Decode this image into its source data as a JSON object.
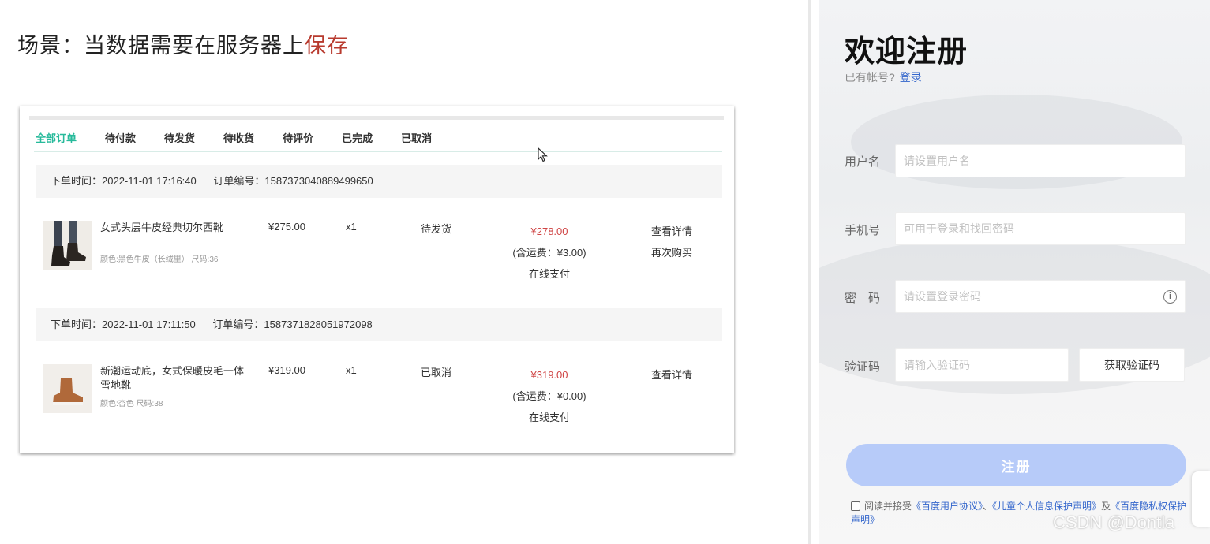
{
  "slide": {
    "title_prefix": "场景：当数据需要在服务器上",
    "title_highlight": "保存"
  },
  "orders": {
    "tabs": [
      {
        "label": "全部订单",
        "active": true
      },
      {
        "label": "待付款",
        "active": false
      },
      {
        "label": "待发货",
        "active": false
      },
      {
        "label": "待收货",
        "active": false
      },
      {
        "label": "待评价",
        "active": false
      },
      {
        "label": "已完成",
        "active": false
      },
      {
        "label": "已取消",
        "active": false
      }
    ],
    "list": [
      {
        "order_time": "下单时间：2022-11-01 17:16:40",
        "order_no": "订单编号：1587373040889499650",
        "goods_name": "女式头层牛皮经典切尔西靴",
        "goods_attr": "颜色:黑色牛皮（长绒里） 尺码:36",
        "price": "¥275.00",
        "qty": "x1",
        "status": "待发货",
        "pay_total": "¥278.00",
        "freight": "(含运费：¥3.00)",
        "pay_type": "在线支付",
        "actions": [
          "查看详情",
          "再次购买"
        ]
      },
      {
        "order_time": "下单时间：2022-11-01 17:11:50",
        "order_no": "订单编号：1587371828051972098",
        "goods_name": "新潮运动底，女式保暖皮毛一体雪地靴",
        "goods_attr": "颜色:杏色 尺码:38",
        "price": "¥319.00",
        "qty": "x1",
        "status": "已取消",
        "pay_total": "¥319.00",
        "freight": "(含运费：¥0.00)",
        "pay_type": "在线支付",
        "actions": [
          "查看详情"
        ]
      }
    ]
  },
  "register": {
    "title": "欢迎注册",
    "have_account": "已有帐号?",
    "login_link": "登录",
    "fields": {
      "username": {
        "label": "用户名",
        "placeholder": "请设置用户名"
      },
      "phone": {
        "label": "手机号",
        "placeholder": "可用于登录和找回密码"
      },
      "password": {
        "label": "密　码",
        "placeholder": "请设置登录密码"
      },
      "code": {
        "label": "验证码",
        "placeholder": "请输入验证码"
      }
    },
    "get_code_button": "获取验证码",
    "submit_button": "注册",
    "agreement": {
      "prefix": "阅读并接受",
      "link1": "《百度用户协议》",
      "sep": "、",
      "link2": "《儿童个人信息保护声明》",
      "and": "及",
      "link3": "《百度隐私权保护声明》"
    }
  },
  "watermark": "CSDN @Dontla",
  "colors": {
    "accent": "#27ba9b",
    "price_red": "#cf4444",
    "link_blue": "#3366cc",
    "submit_bg": "#b7cbf9",
    "title_highlight": "#b83a2e"
  }
}
